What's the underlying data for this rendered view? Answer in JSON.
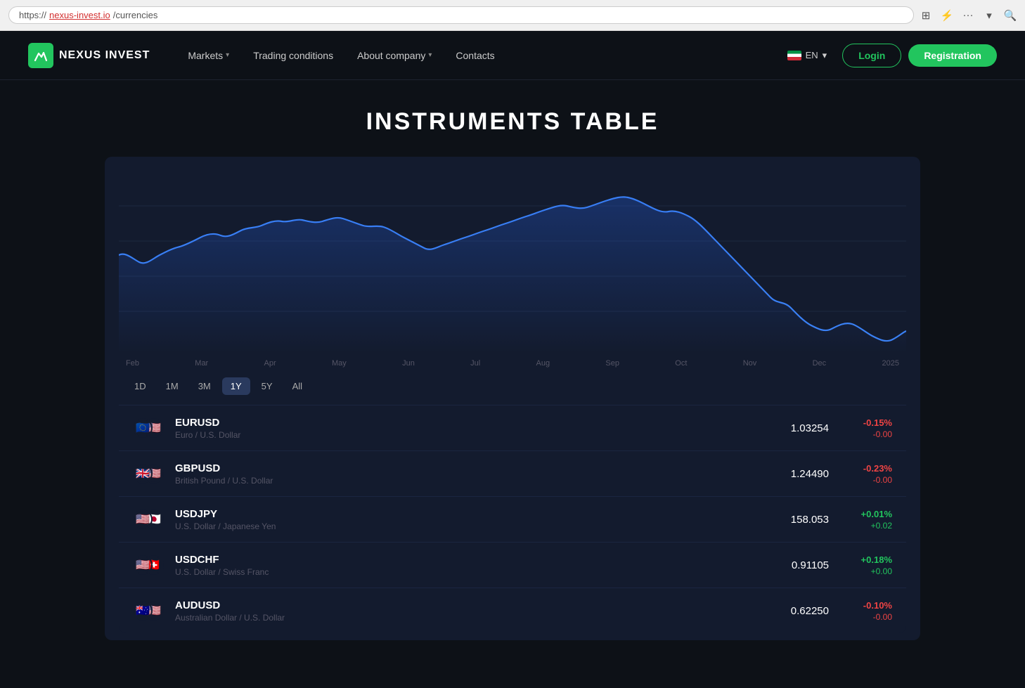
{
  "browser": {
    "url_prefix": "https://",
    "url_highlight": "nexus-invest.io",
    "url_suffix": "/currencies"
  },
  "navbar": {
    "logo_text": "NEXUS INVEST",
    "nav_items": [
      {
        "label": "Markets",
        "has_chevron": true
      },
      {
        "label": "Trading conditions",
        "has_chevron": false
      },
      {
        "label": "About company",
        "has_chevron": true
      },
      {
        "label": "Contacts",
        "has_chevron": false
      }
    ],
    "lang": "EN",
    "login_label": "Login",
    "register_label": "Registration"
  },
  "page": {
    "title": "INSTRUMENTS TABLE"
  },
  "chart": {
    "x_labels": [
      "Feb",
      "Mar",
      "Apr",
      "May",
      "Jun",
      "Jul",
      "Aug",
      "Sep",
      "Oct",
      "Nov",
      "Dec",
      "2025"
    ],
    "time_filters": [
      "1D",
      "1M",
      "3M",
      "1Y",
      "5Y",
      "All"
    ],
    "active_filter": "1Y"
  },
  "instruments": [
    {
      "name": "EURUSD",
      "desc": "Euro / U.S. Dollar",
      "price": "1.03254",
      "change_pct": "-0.15%",
      "change_abs": "-0.00",
      "positive": false,
      "flag1": "🇪🇺",
      "flag2": "🇺🇸"
    },
    {
      "name": "GBPUSD",
      "desc": "British Pound / U.S. Dollar",
      "price": "1.24490",
      "change_pct": "-0.23%",
      "change_abs": "-0.00",
      "positive": false,
      "flag1": "🇬🇧",
      "flag2": "🇺🇸"
    },
    {
      "name": "USDJPY",
      "desc": "U.S. Dollar / Japanese Yen",
      "price": "158.053",
      "change_pct": "+0.01%",
      "change_abs": "+0.02",
      "positive": true,
      "flag1": "🇺🇸",
      "flag2": "🇯🇵"
    },
    {
      "name": "USDCHF",
      "desc": "U.S. Dollar / Swiss Franc",
      "price": "0.91105",
      "change_pct": "+0.18%",
      "change_abs": "+0.00",
      "positive": true,
      "flag1": "🇺🇸",
      "flag2": "🇨🇭"
    },
    {
      "name": "AUDUSD",
      "desc": "Australian Dollar / U.S. Dollar",
      "price": "0.62250",
      "change_pct": "-0.10%",
      "change_abs": "-0.00",
      "positive": false,
      "flag1": "🇦🇺",
      "flag2": "🇺🇸"
    }
  ]
}
